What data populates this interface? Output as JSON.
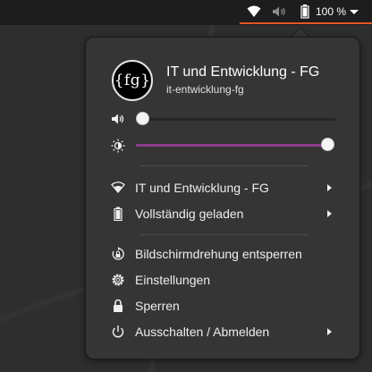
{
  "topbar": {
    "battery_percent": "100 %",
    "icons": [
      "wifi-icon",
      "volume-muted-icon",
      "battery-full-icon",
      "chevron-down-icon"
    ],
    "accent": "#e95420"
  },
  "account": {
    "avatar_text": "{fg}",
    "name": "IT und Entwicklung - FG",
    "username": "it-entwicklung-fg"
  },
  "volume": {
    "icon": "speaker-icon",
    "level": 0.0
  },
  "brightness": {
    "icon": "brightness-icon",
    "level": 1.0,
    "color": "#8e3c8e"
  },
  "network": {
    "icon": "wifi-icon",
    "label": "IT und Entwicklung - FG"
  },
  "power": {
    "icon": "battery-full-icon",
    "label": "Vollständig geladen"
  },
  "actions": {
    "rotation_label": "Bildschirmdrehung entsperren",
    "settings_label": "Einstellungen",
    "lock_label": "Sperren",
    "shutdown_label": "Ausschalten / Abmelden"
  }
}
